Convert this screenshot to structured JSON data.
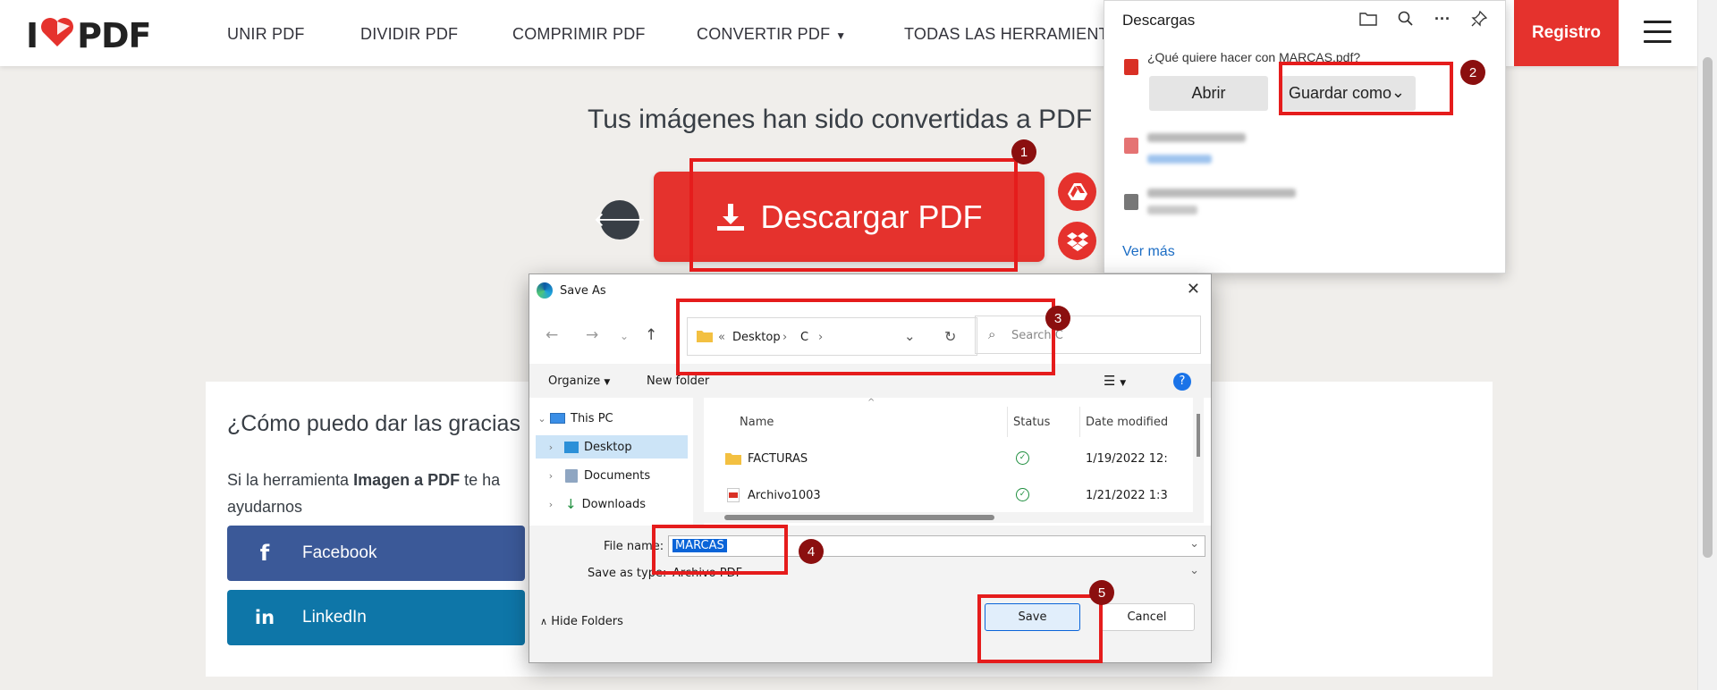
{
  "nav": {
    "logo_left": "I",
    "logo_right": "PDF",
    "items": [
      "UNIR PDF",
      "DIVIDIR PDF",
      "COMPRIMIR PDF",
      "CONVERTIR PDF",
      "TODAS LAS HERRAMIENTA"
    ],
    "register": "Registro"
  },
  "main": {
    "headline": "Tus imágenes han sido convertidas a PDF",
    "download_label": "Descargar PDF"
  },
  "thanks": {
    "title": "¿Cómo puedo dar las gracias",
    "text_pre": "Si la herramienta ",
    "text_bold": "Imagen a PDF",
    "text_post": " te ha",
    "text_line2": "ayudarnos",
    "facebook": "Facebook",
    "facebook_icon": "f",
    "linkedin": "LinkedIn",
    "linkedin_icon": "in"
  },
  "downloads": {
    "title": "Descargas",
    "question": "¿Qué quiere hacer con MARCAS.pdf?",
    "open": "Abrir",
    "save_as": "Guardar como",
    "more": "Ver más"
  },
  "dialog": {
    "title": "Save As",
    "breadcrumb_prefix": "«",
    "breadcrumb": [
      "Desktop",
      "C"
    ],
    "search_placeholder": "Search C",
    "organize": "Organize",
    "new_folder": "New folder",
    "nav_items": [
      "This PC",
      "Desktop",
      "Documents",
      "Downloads"
    ],
    "columns": [
      "Name",
      "Status",
      "Date modified"
    ],
    "files": [
      {
        "name": "FACTURAS",
        "type": "folder",
        "date": "1/19/2022 12:"
      },
      {
        "name": "Archivo1003",
        "type": "pdf",
        "date": "1/21/2022 1:3"
      }
    ],
    "file_name_label": "File name:",
    "file_name_value": "MARCAS",
    "save_type_label": "Save as type:",
    "save_type_value": "Archivo PDF",
    "hide_folders": "Hide Folders",
    "save": "Save",
    "cancel": "Cancel"
  },
  "annotations": [
    "1",
    "2",
    "3",
    "4",
    "5"
  ],
  "colors": {
    "brand_red": "#e5322d",
    "highlight_red": "#e51c1c",
    "badge_dark_red": "#8b0f0f",
    "facebook_blue": "#3b5998",
    "linkedin_blue": "#0e76a8",
    "link_blue": "#1a6cc4"
  }
}
